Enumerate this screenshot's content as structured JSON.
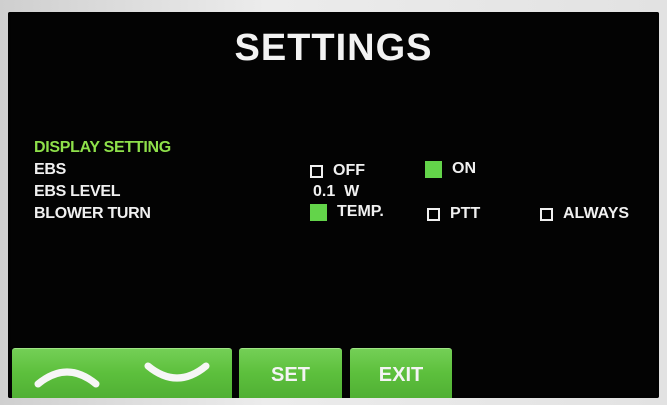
{
  "screen": {
    "title": "SETTINGS"
  },
  "settings": {
    "section_label": "DISPLAY SETTING",
    "ebs": {
      "label": "EBS",
      "options": [
        {
          "label": "OFF",
          "checked": false
        },
        {
          "label": "ON",
          "checked": true
        }
      ]
    },
    "ebs_level": {
      "label": "EBS LEVEL",
      "value": "0.1",
      "unit": "W"
    },
    "blower_turn": {
      "label": "BLOWER TURN",
      "options": [
        {
          "label": "TEMP.",
          "checked": true
        },
        {
          "label": "PTT",
          "checked": false
        },
        {
          "label": "ALWAYS",
          "checked": false
        }
      ]
    }
  },
  "buttons": {
    "up_icon": "chevron-up-icon",
    "down_icon": "chevron-down-icon",
    "set_label": "SET",
    "exit_label": "EXIT"
  },
  "colors": {
    "background": "#030303",
    "text": "#f0f0f0",
    "section_label": "#8ee04a",
    "checked_box": "#63d44a",
    "button_green": "#5dc03d"
  }
}
